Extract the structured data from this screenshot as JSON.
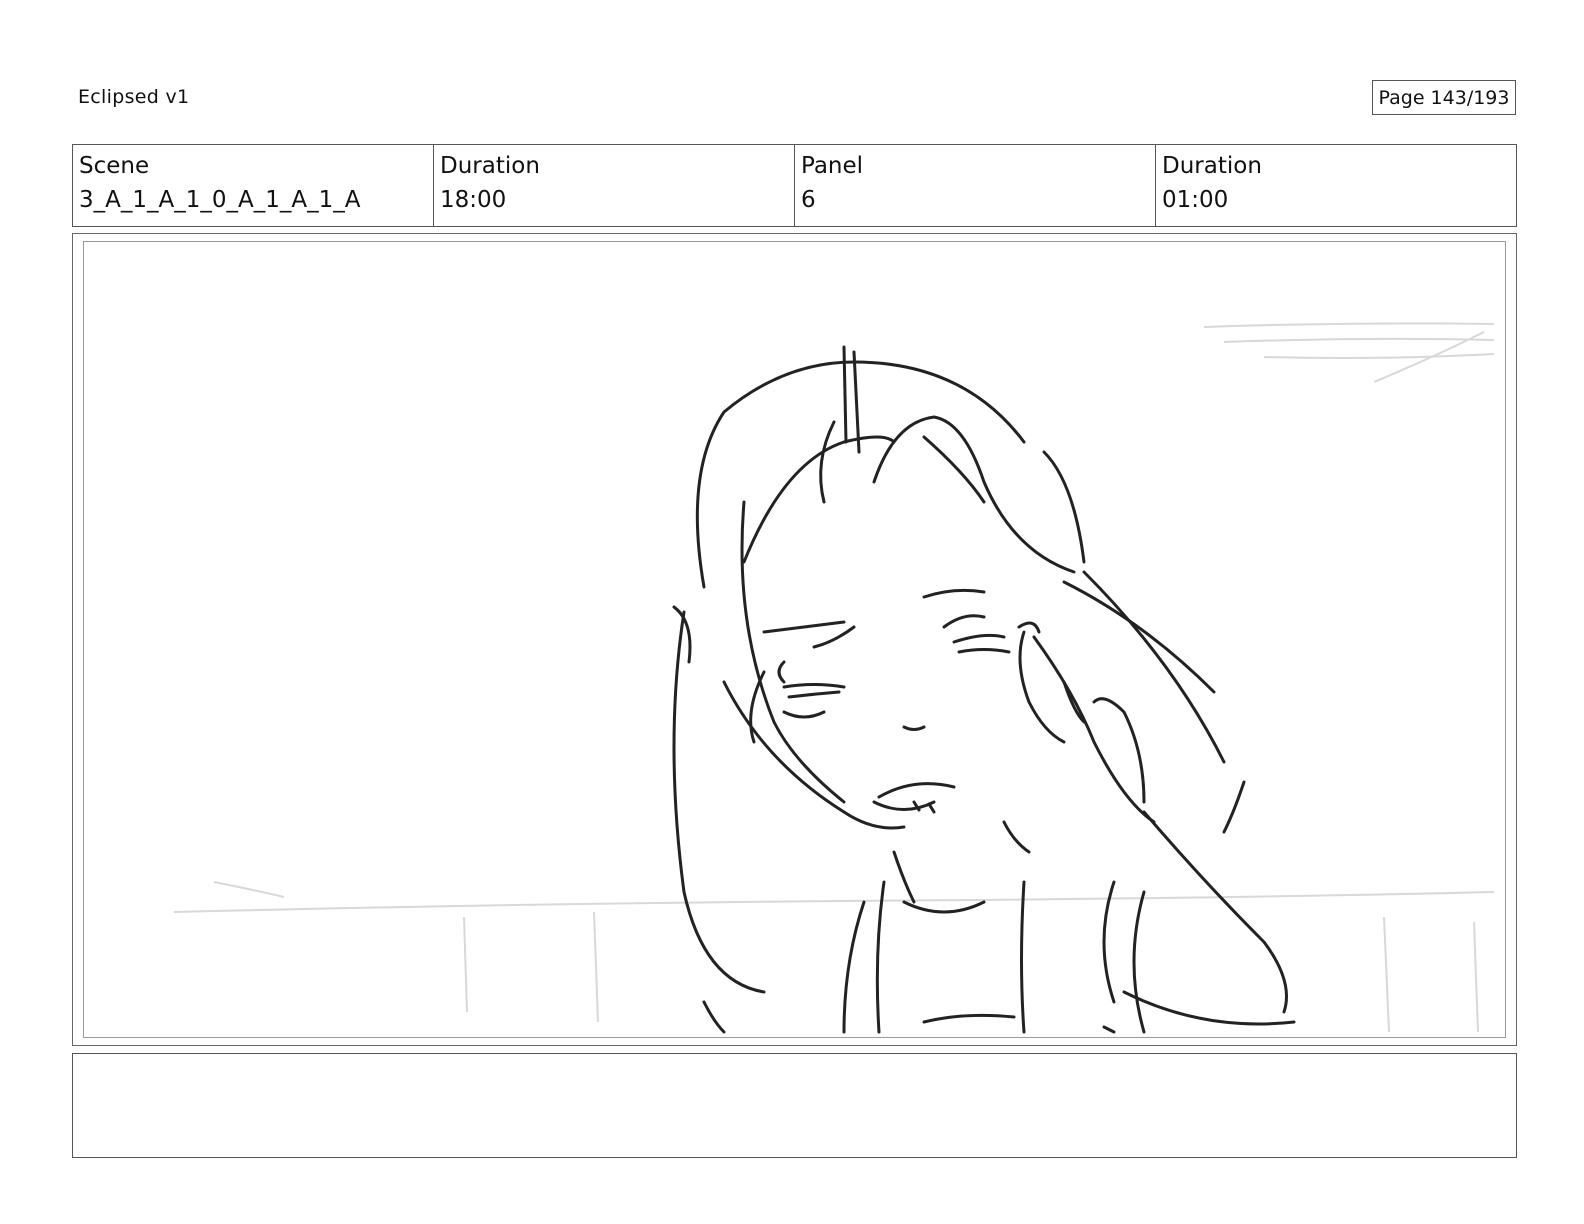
{
  "header": {
    "document_title": "Eclipsed v1",
    "page_number": "Page 143/193"
  },
  "info": {
    "scene_label": "Scene",
    "scene_value": "3_A_1_A_1_0_A_1_A_1_A",
    "scene_duration_label": "Duration",
    "scene_duration_value": "18:00",
    "panel_label": "Panel",
    "panel_value": "6",
    "panel_duration_label": "Duration",
    "panel_duration_value": "01:00"
  },
  "panel": {
    "image_description_icon": "storyboard-sketch"
  },
  "notes": {
    "text": ""
  }
}
